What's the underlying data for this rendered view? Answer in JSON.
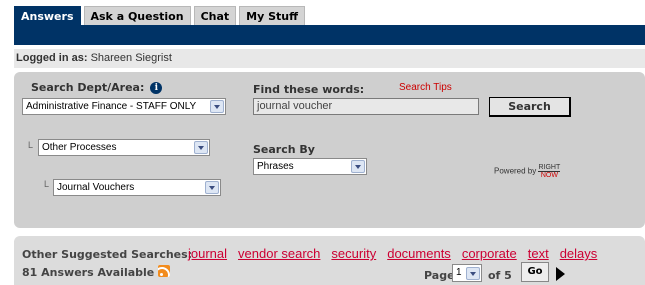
{
  "tabs": [
    {
      "label": "Answers",
      "active": true
    },
    {
      "label": "Ask a Question",
      "active": false
    },
    {
      "label": "Chat",
      "active": false
    },
    {
      "label": "My Stuff",
      "active": false
    }
  ],
  "session": {
    "prefix": "Logged in as:",
    "user": "Shareen Siegrist"
  },
  "search": {
    "dept_label": "Search Dept/Area:",
    "dept_value": "Administrative Finance - STAFF ONLY",
    "sub1_value": "Other Processes",
    "sub2_value": "Journal Vouchers",
    "find_label": "Find these words:",
    "tips_label": "Search Tips",
    "query": "journal voucher",
    "button_label": "Search",
    "searchby_label": "Search By",
    "searchby_value": "Phrases",
    "powered_label": "Powered by",
    "logo_top": "RIGHT",
    "logo_bottom": "NOW"
  },
  "suggestions": {
    "label": "Other Suggested Searches:",
    "links": [
      "journal",
      "vendor search",
      "security",
      "documents",
      "corporate",
      "text",
      "delays"
    ]
  },
  "results": {
    "count_text": "81 Answers Available"
  },
  "pager": {
    "page_label": "Page:",
    "current": "1",
    "of_text": "of 5",
    "go_label": "Go"
  },
  "colors": {
    "nav": "#003366",
    "link": "#cc0033",
    "panel": "#cfcfcf"
  }
}
